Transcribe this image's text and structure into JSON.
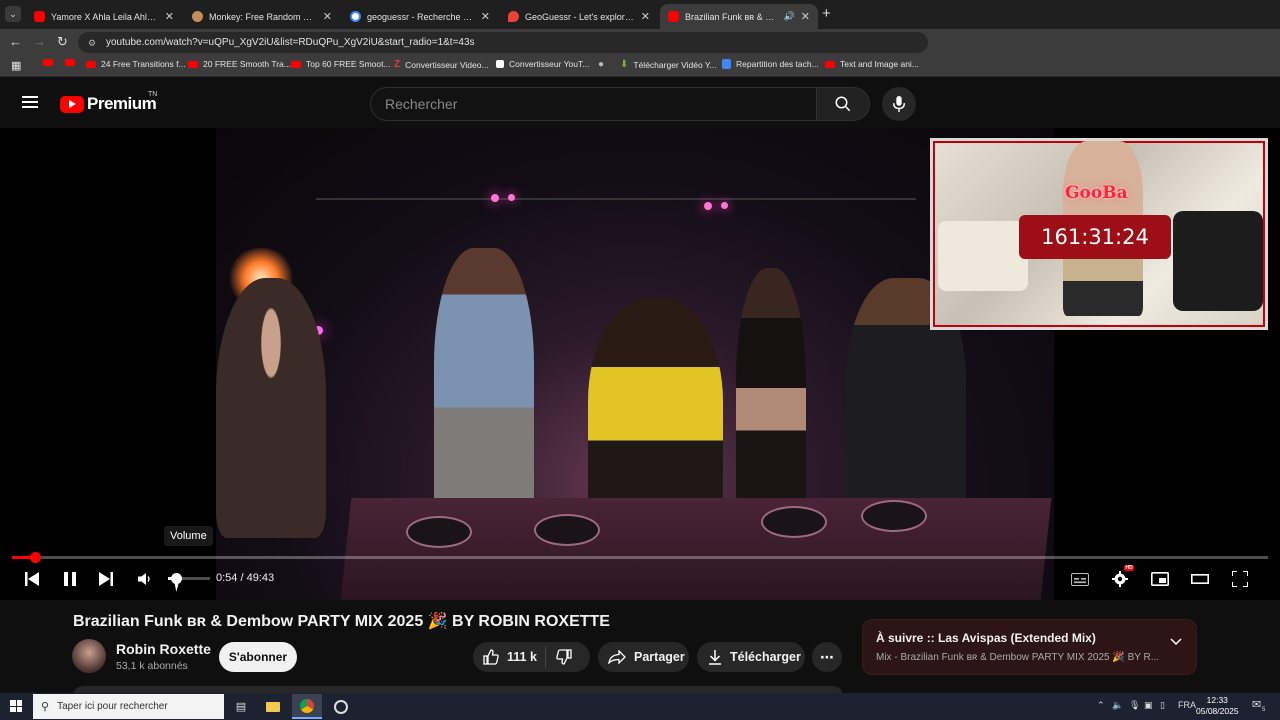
{
  "browser": {
    "tabs": [
      {
        "title": "Yamore X Ahla Leila Ahla Nas (M",
        "color": "#ff0000"
      },
      {
        "title": "Monkey: Free Random Video",
        "color": "#c48d5a"
      },
      {
        "title": "geoguessr - Recherche Google",
        "color": "#4285f4"
      },
      {
        "title": "GeoGuessr - Let's explore the w",
        "color": "#ea4335"
      },
      {
        "title": "Brazilian Funk ʙʀ & Dembow P",
        "color": "#ff0000"
      }
    ],
    "url": "youtube.com/watch?v=uQPu_XgV2iU&list=RDuQPu_XgV2iU&start_radio=1&t=43s",
    "bookmarks": [
      "24 Free Transitions f...",
      "20 FREE Smooth Tra...",
      "Top 60 FREE Smoot...",
      "Convertisseur Video...",
      "Convertisseur YouT...",
      "Télécharger Vidéo Y...",
      "Repartition des tach...",
      "Text and Image ani..."
    ]
  },
  "youtube": {
    "logo_text": "Premium",
    "logo_region": "TN",
    "search_placeholder": "Rechercher",
    "player": {
      "time": "0:54 / 49:43",
      "tooltip": "Volume",
      "progress": 0.018,
      "volume": 0.15
    },
    "video_title": "Brazilian Funk ʙʀ & Dembow PARTY MIX 2025 🎉 BY ROBIN ROXETTE",
    "channel": {
      "name": "Robin Roxette",
      "subscribers": "53,1 k abonnés"
    },
    "subscribe_label": "S'abonner",
    "likes": "111 k",
    "share_label": "Partager",
    "download_label": "Télécharger",
    "up_next": {
      "title": "À suivre :: Las Avispas (Extended Mix)",
      "subtitle": "Mix - Brazilian Funk ʙʀ & Dembow PARTY MIX 2025 🎉 BY R..."
    }
  },
  "stream_overlay": {
    "label": "GooBa",
    "timer": "161:31:24"
  },
  "taskbar": {
    "search_placeholder": "Taper ici pour rechercher",
    "language": "FRA",
    "time": "12:33",
    "date": "05/08/2025",
    "notifications": "5"
  }
}
